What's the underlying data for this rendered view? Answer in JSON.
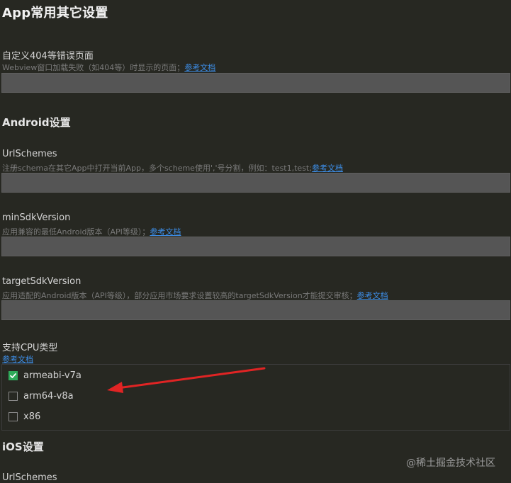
{
  "page": {
    "title": "App常用其它设置"
  },
  "error_page": {
    "label": "自定义404等错误页面",
    "description": "Webview窗口加载失败（如404等）时显示的页面；",
    "link": "参考文档",
    "value": ""
  },
  "android": {
    "title": "Android设置",
    "url_schemes": {
      "label": "UrlSchemes",
      "description": "注册schema在其它App中打开当前App，多个scheme使用','号分割，例如：test1,test;",
      "link": "参考文档",
      "value": ""
    },
    "min_sdk": {
      "label": "minSdkVersion",
      "description": "应用兼容的最低Android版本（API等级）；",
      "link": "参考文档",
      "value": ""
    },
    "target_sdk": {
      "label": "targetSdkVersion",
      "description": "应用适配的Android版本（API等级），部分应用市场要求设置较高的targetSdkVersion才能提交审核；",
      "link": "参考文档",
      "value": ""
    },
    "cpu": {
      "label": "支持CPU类型",
      "link": "参考文档",
      "options": [
        {
          "label": "armeabi-v7a",
          "checked": true
        },
        {
          "label": "arm64-v8a",
          "checked": false
        },
        {
          "label": "x86",
          "checked": false
        }
      ]
    }
  },
  "ios": {
    "title": "iOS设置",
    "url_schemes_label": "UrlSchemes"
  },
  "annotation": {
    "arrow_color": "#e02424"
  },
  "colors": {
    "background": "#272822",
    "input_background": "#555555",
    "link": "#3d8ee8",
    "checkbox_checked": "#2faa5a"
  },
  "watermark": "@稀土掘金技术社区"
}
